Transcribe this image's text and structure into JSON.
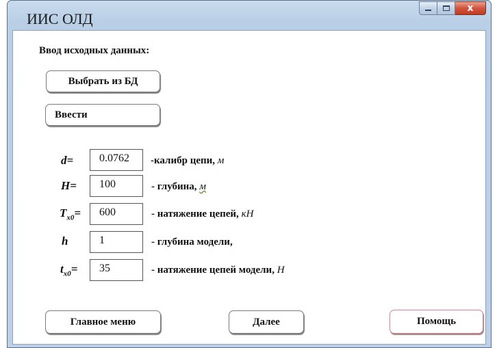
{
  "window": {
    "title": "ИИС ОЛД",
    "controls": {
      "minimize": "minimize-icon",
      "maximize": "maximize-icon",
      "close": "close-icon"
    },
    "close_glyph": "x"
  },
  "form": {
    "heading": "Ввод исходных данных:",
    "select_db_label": "Выбрать из БД",
    "enter_label": "Ввести",
    "params": [
      {
        "symbol": "d",
        "sub": "",
        "eq": "=",
        "value": "0.0762",
        "desc": "-калибр цепи, ",
        "unit": "м"
      },
      {
        "symbol": "H",
        "sub": "",
        "eq": "=",
        "value": "100",
        "desc": " - глубина, ",
        "unit": "м"
      },
      {
        "symbol": "T",
        "sub": "x0",
        "eq": "=",
        "value": "600",
        "desc": " - натяжение цепей, ",
        "unit": "кН"
      },
      {
        "symbol": "h",
        "sub": "",
        "eq": "",
        "value": "1",
        "desc": " - глубина модели,",
        "unit": ""
      },
      {
        "symbol": "t",
        "sub": "x0",
        "eq": "=",
        "value": "35",
        "desc": " - натяжение цепей модели, ",
        "unit": "Н"
      }
    ]
  },
  "footer": {
    "main_menu_label": "Главное меню",
    "next_label": "Далее",
    "help_label": "Помощь"
  }
}
